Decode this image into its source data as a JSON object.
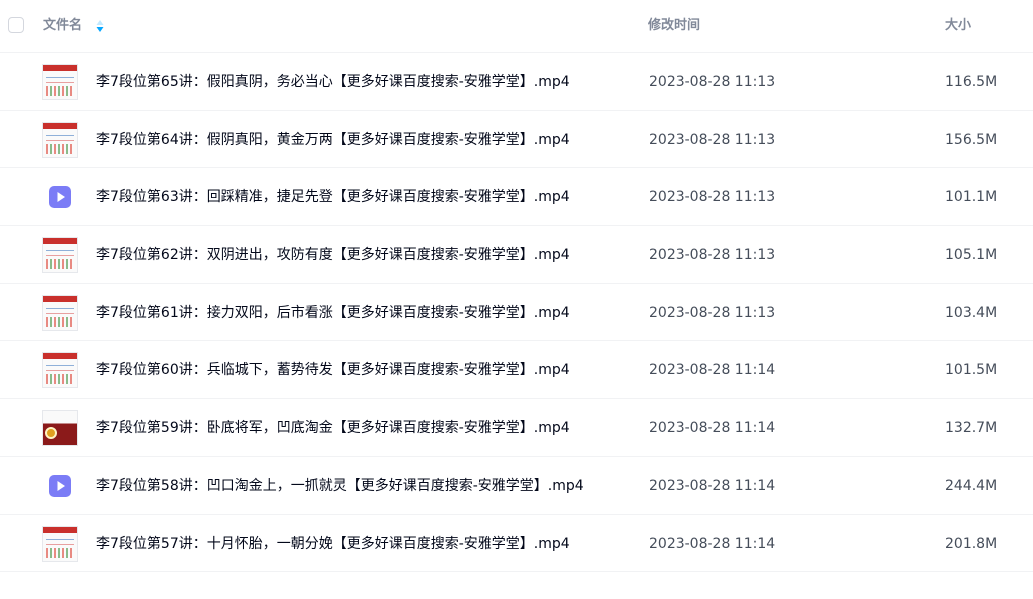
{
  "header": {
    "name_label": "文件名",
    "time_label": "修改时间",
    "size_label": "大小"
  },
  "colors": {
    "sort_icon": "#06a7ff",
    "video_icon": "#7b7cf6"
  },
  "files": [
    {
      "name": "李7段位第65讲：假阳真阴，务必当心【更多好课百度搜索-安雅学堂】.mp4",
      "time": "2023-08-28 11:13",
      "size": "116.5M",
      "thumb": "chart"
    },
    {
      "name": "李7段位第64讲：假阴真阳，黄金万两【更多好课百度搜索-安雅学堂】.mp4",
      "time": "2023-08-28 11:13",
      "size": "156.5M",
      "thumb": "chart"
    },
    {
      "name": "李7段位第63讲：回踩精准，捷足先登【更多好课百度搜索-安雅学堂】.mp4",
      "time": "2023-08-28 11:13",
      "size": "101.1M",
      "thumb": "video"
    },
    {
      "name": "李7段位第62讲：双阴进出，攻防有度【更多好课百度搜索-安雅学堂】.mp4",
      "time": "2023-08-28 11:13",
      "size": "105.1M",
      "thumb": "chart"
    },
    {
      "name": "李7段位第61讲：接力双阳，后市看涨【更多好课百度搜索-安雅学堂】.mp4",
      "time": "2023-08-28 11:13",
      "size": "103.4M",
      "thumb": "chart"
    },
    {
      "name": "李7段位第60讲：兵临城下，蓄势待发【更多好课百度搜索-安雅学堂】.mp4",
      "time": "2023-08-28 11:14",
      "size": "101.5M",
      "thumb": "chart"
    },
    {
      "name": "李7段位第59讲：卧底将军，凹底淘金【更多好课百度搜索-安雅学堂】.mp4",
      "time": "2023-08-28 11:14",
      "size": "132.7M",
      "thumb": "chart-dark"
    },
    {
      "name": "李7段位第58讲：凹口淘金上，一抓就灵【更多好课百度搜索-安雅学堂】.mp4",
      "time": "2023-08-28 11:14",
      "size": "244.4M",
      "thumb": "video"
    },
    {
      "name": "李7段位第57讲：十月怀胎，一朝分娩【更多好课百度搜索-安雅学堂】.mp4",
      "time": "2023-08-28 11:14",
      "size": "201.8M",
      "thumb": "chart"
    }
  ]
}
